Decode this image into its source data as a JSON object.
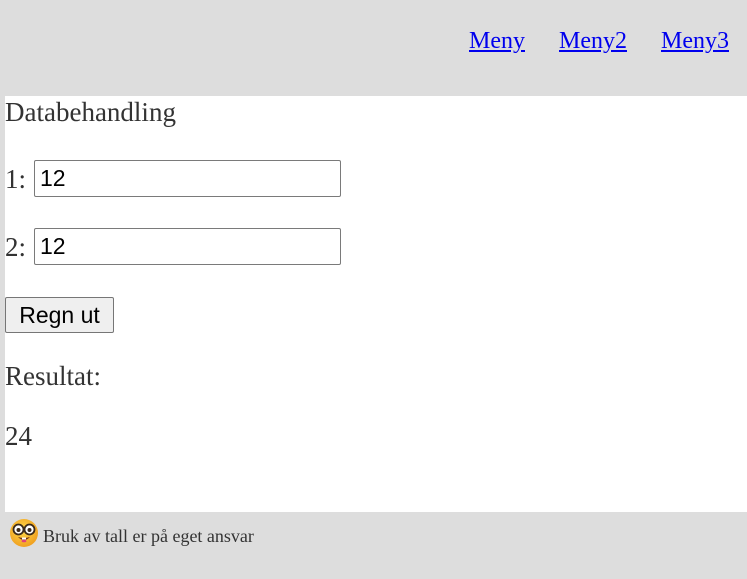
{
  "nav": {
    "items": [
      {
        "label": "Meny"
      },
      {
        "label": "Meny2"
      },
      {
        "label": "Meny3"
      }
    ]
  },
  "main": {
    "title": "Databehandling",
    "field1": {
      "label": "1:",
      "value": "12"
    },
    "field2": {
      "label": "2:",
      "value": "12"
    },
    "calculate_label": "Regn ut",
    "result_label": "Resultat:",
    "result_value": "24"
  },
  "footer": {
    "icon": "nerd-face-emoji-icon",
    "text": "Bruk av tall er på eget ansvar"
  },
  "colors": {
    "background": "#dddddd",
    "content": "#ffffff",
    "link": "#0000ee",
    "text": "#333333"
  }
}
